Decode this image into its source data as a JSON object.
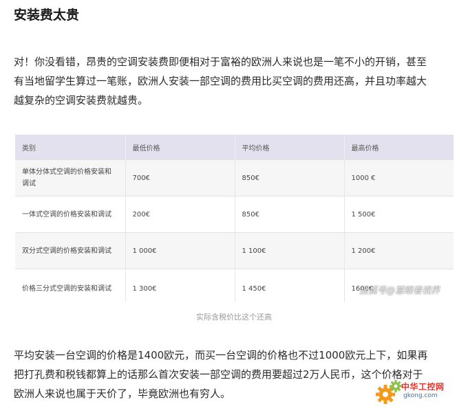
{
  "article": {
    "title": "安装费太贵",
    "paragraph1": [
      "对！你没看错，昂贵的空调安装费即便相对于富裕的欧洲人来说也是一笔不小的开销，甚至",
      "有当地留学生算过一笔账，欧洲人安装一部空调的费用比买空调的费用还高，并且功率越大",
      "越复杂的空调安装费就越贵。"
    ],
    "table": {
      "headers": [
        "类别",
        "最低价格",
        "平均价格",
        "最高价格"
      ],
      "rows": [
        [
          "单体分体式空调的价格安装和调试",
          "700€",
          "850€",
          "1000 €"
        ],
        [
          "一体式空调的价格安装和调试",
          "200€",
          "850€",
          "1 500€"
        ],
        [
          "双分式空调的价格安装和调试",
          "1 000€",
          "1 100€",
          "1 200€"
        ],
        [
          "价格三分式空调的安装和调试",
          "1 300€",
          "1 450€",
          "1600€"
        ]
      ]
    },
    "caption": "实际含税价比这个还高",
    "paragraph2": [
      "平均安装一台空调的价格是1400欧元，而买一台空调的价格也不过1000欧元上下，如果再",
      "把打孔费和税钱都算上的话那么首次安装一部空调的费用要超过2万人民币，这个价格对于",
      "欧洲人来说也属于天价了，毕竟欧洲也有穷人。"
    ]
  },
  "watermark": {
    "text": "搜狐号@慧眼看视界"
  },
  "logo": {
    "name": "中华工控网",
    "url": "gkong.com",
    "icon": "gear-icon",
    "colors": {
      "gear_orange": "#f29a1a",
      "gear_green": "#8bc34a",
      "text_red": "#e8322b",
      "url_blue": "#3a6fb0"
    }
  },
  "colors": {
    "table_header_bg": "#e4e1ef",
    "table_odd_row_bg": "#f6f6f6",
    "caption_text": "#9a9a9a"
  }
}
